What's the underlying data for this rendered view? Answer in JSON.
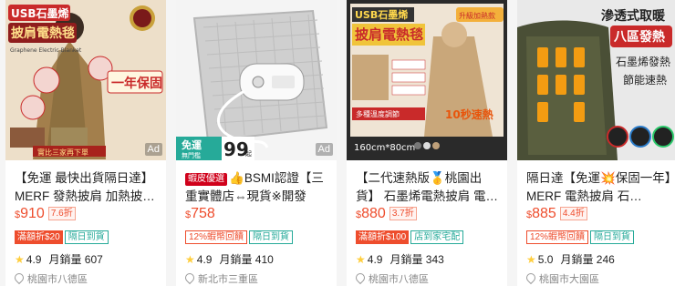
{
  "products": [
    {
      "img_text": {
        "a": "USB石墨烯",
        "b": "披肩電熱毯",
        "c": "Graphene Electric Blanket",
        "d": "一年保固",
        "e": "實比三家再下單",
        "ad": "Ad"
      },
      "title": "【免運 最快出貨隔日達】 MERF 發熱披肩 加熱披…",
      "mall": "",
      "price_symbol": "$",
      "price": "910",
      "discount": "7.6折",
      "tag1": "滿額折$20",
      "tag2": "隔日到貨",
      "rating": "4.9",
      "sold": "月銷量 607",
      "location": "桃園市八德區"
    },
    {
      "img_text": {
        "a": "免運",
        "b": "無門檻",
        "c": "99",
        "d": "起",
        "ad": "Ad"
      },
      "title": "BSMI認證【三重實體店⇔現貨※開發票】…",
      "mall": "蝦皮優選",
      "price_symbol": "$",
      "price": "758",
      "discount": "",
      "tag1": "12%蝦幣回饋",
      "tag2": "隔日到貨",
      "rating": "4.9",
      "sold": "月銷量 410",
      "location": "新北市三重區"
    },
    {
      "img_text": {
        "a": "USB石墨烯",
        "b": "披肩電熱毯",
        "c": "升級加熱款",
        "d": "多種溫度調節",
        "e": "10秒速熱",
        "f": "160cm*80cm"
      },
      "title": "【二代速熱版🥇桃園出貨】 石墨烯電熱披肩 電…",
      "mall": "",
      "price_symbol": "$",
      "price": "880",
      "discount": "3.7折",
      "tag1": "滿額折$100",
      "tag2": "店到家宅配",
      "rating": "4.9",
      "sold": "月銷量 343",
      "location": "桃園市八德區"
    },
    {
      "img_text": {
        "a": "滲透式取暖",
        "b": "八區發熱",
        "c": "石墨烯發熱",
        "d": "節能速熱"
      },
      "title": "隔日達【免運💥保固一年】MERF 電熱披肩 石…",
      "mall": "",
      "price_symbol": "$",
      "price": "885",
      "discount": "4.4折",
      "tag1": "12%蝦幣回饋",
      "tag2": "隔日到貨",
      "rating": "5.0",
      "sold": "月銷量 246",
      "location": "桃園市大園區"
    }
  ]
}
